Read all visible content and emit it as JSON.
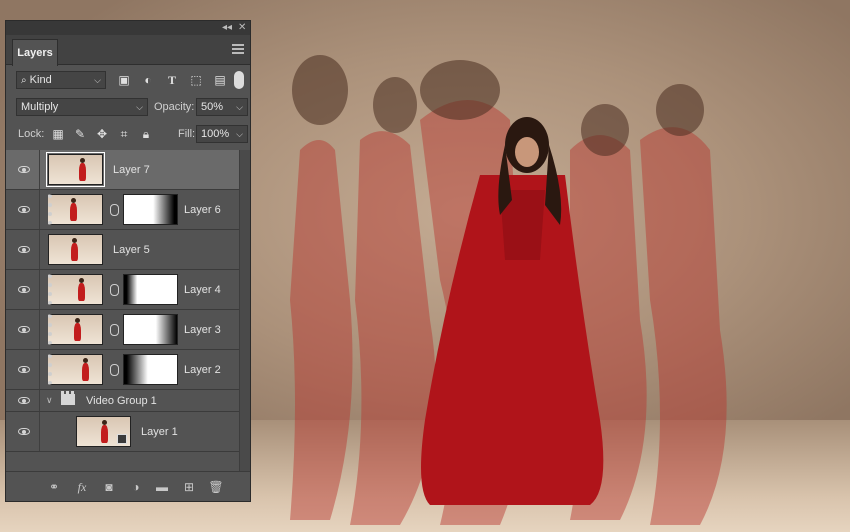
{
  "panel": {
    "collapse_icon": "double-chevron-left",
    "close_icon": "close-x",
    "tab_label": "Layers",
    "menu_icon": "hamburger-menu"
  },
  "filter": {
    "kind_label": "Kind",
    "icons": [
      "pixel-filter-icon",
      "adjustment-filter-icon",
      "type-filter-icon",
      "shape-filter-icon",
      "smart-object-filter-icon"
    ]
  },
  "blend": {
    "mode": "Multiply",
    "opacity_label": "Opacity:",
    "opacity_value": "50%"
  },
  "lock": {
    "label": "Lock:",
    "fill_label": "Fill:",
    "fill_value": "100%"
  },
  "layers": [
    {
      "name": "Layer 7",
      "selected": true,
      "mask": false
    },
    {
      "name": "Layer 6",
      "selected": false,
      "mask": true
    },
    {
      "name": "Layer 5",
      "selected": false,
      "mask": false
    },
    {
      "name": "Layer 4",
      "selected": false,
      "mask": true
    },
    {
      "name": "Layer 3",
      "selected": false,
      "mask": true
    },
    {
      "name": "Layer 2",
      "selected": false,
      "mask": true
    }
  ],
  "video_group": {
    "name": "Video Group 1",
    "child": "Layer 1"
  },
  "bottom_icons": [
    "link-layers-icon",
    "fx-icon",
    "add-mask-icon",
    "adjustment-layer-icon",
    "new-group-icon",
    "new-layer-icon",
    "delete-icon"
  ],
  "colors": {
    "panel_bg": "#535353",
    "selected_row": "#6a6a6a",
    "dress_red": "#c21d1d"
  }
}
